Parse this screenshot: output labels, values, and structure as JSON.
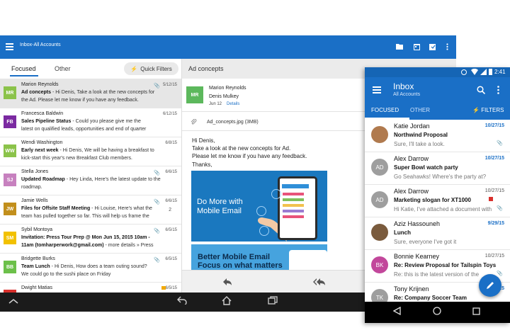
{
  "tablet": {
    "header": {
      "title": "Inbox-All Accounts"
    },
    "tabs": {
      "focused": "Focused",
      "other": "Other"
    },
    "quick_filters": "Quick Filters",
    "messages": [
      {
        "initials": "MR",
        "color": "#8bc34a",
        "from": "Marion Reynolds",
        "subject": "Ad concepts",
        "preview": " - Hi Denis, Take a look at the new concepts for",
        "line2": "the Ad. Please let me know if you have any feedback.",
        "date": "5/12/15",
        "clip": true,
        "count": "",
        "selected": true
      },
      {
        "initials": "FB",
        "color": "#7b2aa1",
        "from": "Francesca Baldwin",
        "subject": "Sales Pipeline Status",
        "preview": " - Could you please give me the",
        "line2": "latest on qualified leads, opportunities and end of quarter",
        "date": "6/12/15",
        "clip": false,
        "count": "",
        "selected": false
      },
      {
        "initials": "WW",
        "color": "#8bc34a",
        "from": "Wendi Washington",
        "subject": "Early next week",
        "preview": " - Hi Denis, We will be having a  breakfast to",
        "line2": "kick-start this year's new Breakfast Club members.",
        "date": "6/8/15",
        "clip": false,
        "count": "",
        "selected": false
      },
      {
        "initials": "SJ",
        "color": "#c781bf",
        "from": "Stella Jones",
        "subject": "Updated Roadmap",
        "preview": " - Hey Linda, Here's the latest update to the",
        "line2": "roadmap.",
        "date": "6/6/15",
        "clip": true,
        "count": "",
        "selected": false
      },
      {
        "initials": "JW",
        "color": "#c28f1c",
        "from": "Jamie Wells",
        "subject": "Files for Offsite Staff Meeting",
        "preview": " - Hi Louise, Here's what the",
        "line2": "team has pulled together so far. This will help us frame the",
        "date": "6/6/15",
        "clip": true,
        "count": "2",
        "selected": false
      },
      {
        "initials": "SM",
        "color": "#f2c100",
        "from": "Sybil Montoya",
        "subject": "Invitation: Press Tour Prep @ Mon Jun 15, 2015 10am -",
        "preview": "",
        "line2": "11am (tomharperwork@gmail.com)",
        "line2_extra": " - more details » Press",
        "date": "6/5/15",
        "clip": true,
        "count": "",
        "selected": false
      },
      {
        "initials": "BB",
        "color": "#6cc04a",
        "from": "Bridgette Burks",
        "subject": "Team Lunch",
        "preview": " - Hi Denis, How does a team outing sound?",
        "line2": "We could go to the sushi place on Friday",
        "date": "6/5/15",
        "clip": true,
        "count": "",
        "selected": false
      },
      {
        "initials": "DM",
        "color": "#d9302c",
        "from": "Dwight Matias",
        "subject": "",
        "preview": "",
        "line2": "",
        "date": "6/5/15",
        "clip": false,
        "count": "",
        "selected": false
      }
    ],
    "reading": {
      "title": "Ad concepts",
      "initials": "MR",
      "from": "Marion Reynolds",
      "to": "Denis Mulkey",
      "date": "Jun 12",
      "details": "Details",
      "attachment": "Ad_concepts.jpg (3MB)",
      "body": [
        "Hi Denis,",
        "Take a look at the new concepts for Ad.",
        "Please let me know if you have any feedback.",
        "Thanks,"
      ],
      "banner1": "Do More with Mobile Email",
      "banner2": "Better Mobile Email Focus on what matters"
    }
  },
  "phone": {
    "status": {
      "time": "2:41"
    },
    "title": "Inbox",
    "subtitle": "All Accounts",
    "tabs": {
      "focused": "FOCUSED",
      "other": "OTHER",
      "filters": "FILTERS"
    },
    "messages": [
      {
        "initials": "",
        "color": "#b07a4e",
        "from": "Katie Jordan",
        "subject": "Northwind Proposal",
        "preview": "Sure, I'll take a look.",
        "date": "10/27/15",
        "date_blue": true,
        "clip": true
      },
      {
        "initials": "AD",
        "color": "#9e9e9e",
        "from": "Alex Darrow",
        "subject": "Super Bowl watch party",
        "preview": "Go Seahawks! Where's the party at?",
        "date": "10/27/15",
        "date_blue": true,
        "clip": false
      },
      {
        "initials": "AD",
        "color": "#9e9e9e",
        "from": "Alex Darrow",
        "subject": "Marketing slogan for XT1000",
        "preview": "Hi Katie, I've attached a document with",
        "date": "10/27/15",
        "date_blue": false,
        "clip": true
      },
      {
        "initials": "",
        "color": "#7a5b3d",
        "from": "Aziz Hassouneh",
        "subject": "Lunch",
        "preview": "Sure, everyone I've got it",
        "date": "9/29/15",
        "date_blue": true,
        "clip": false
      },
      {
        "initials": "BK",
        "color": "#c2479b",
        "from": "Bonnie Kearney",
        "subject": "Re: Review Proposal for Tailspin Toys",
        "preview": "Re: this is the latest version of the",
        "date": "10/27/15",
        "date_blue": false,
        "clip": true
      },
      {
        "initials": "TK",
        "color": "#9e9e9e",
        "from": "Tony Krijnen",
        "subject": "Re: Company Soccer Team",
        "preview": "Yes, I think we've decided on a",
        "date": "10/27/15",
        "date_blue": true,
        "clip": false
      }
    ]
  },
  "colors": {
    "accent": "#1a6fc6"
  }
}
